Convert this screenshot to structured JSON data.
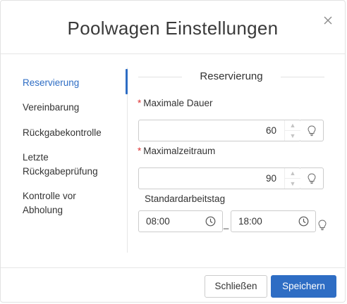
{
  "dialog": {
    "title": "Poolwagen Einstellungen",
    "close_icon": "close-icon"
  },
  "nav": {
    "items": [
      {
        "label": "Reservierung",
        "active": true
      },
      {
        "label": "Vereinbarung",
        "active": false
      },
      {
        "label": "Rückgabekontrolle",
        "active": false
      },
      {
        "label": "Letzte Rückgabeprüfung",
        "active": false
      },
      {
        "label": "Kontrolle vor Abholung",
        "active": false
      }
    ]
  },
  "section": {
    "title": "Reservierung"
  },
  "form": {
    "max_duration": {
      "required_mark": "*",
      "label": "Maximale Dauer",
      "value": "60",
      "icon": "lightbulb-icon"
    },
    "max_period": {
      "required_mark": "*",
      "label": "Maximalzeitraum",
      "value": "90",
      "icon": "lightbulb-icon"
    },
    "workday": {
      "label": "Standardarbeitstag",
      "start": "08:00",
      "separator": "_",
      "end": "18:00",
      "icon": "clock-icon"
    }
  },
  "footer": {
    "close_label": "Schließen",
    "save_label": "Speichern"
  },
  "colors": {
    "accent": "#2e6dc4",
    "required": "#dd3333"
  }
}
